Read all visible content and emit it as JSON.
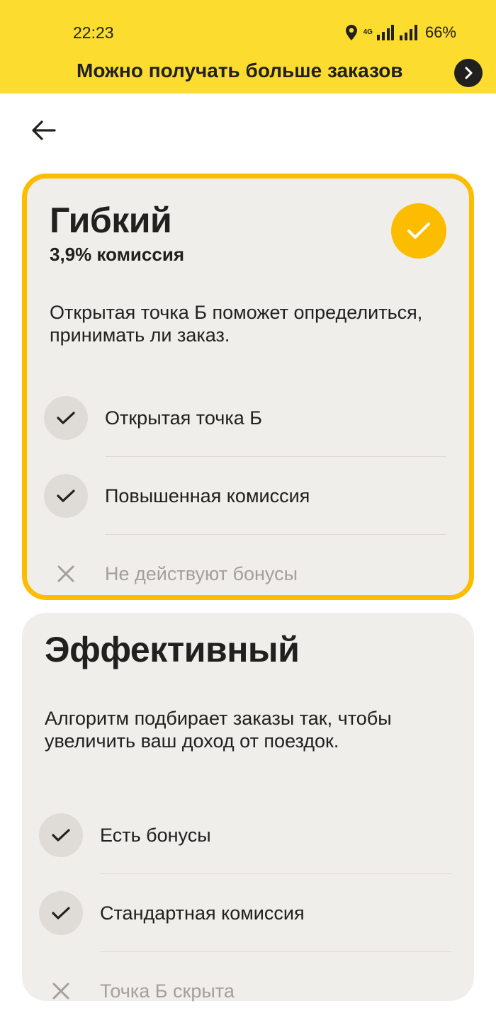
{
  "status_bar": {
    "time": "22:23",
    "network": "4G",
    "battery": "66%",
    "icons": [
      "location-icon",
      "mobile-data-icon",
      "signal-icon"
    ]
  },
  "banner": {
    "text": "Можно получать больше заказов",
    "icon": "chevron-right-icon"
  },
  "nav": {
    "back_icon": "arrow-left-icon"
  },
  "colors": {
    "header_bg": "#fcdc2e",
    "accent": "#fcbc00",
    "card_bg": "#f0eeeb",
    "text": "#21201f",
    "muted": "#a3a09c"
  },
  "modes": [
    {
      "title": "Гибкий",
      "commission": "3,9% комиссия",
      "selected": true,
      "description": "Открытая точка Б поможет определиться, принимать ли заказ.",
      "features": [
        {
          "label": "Открытая точка Б",
          "included": true
        },
        {
          "label": "Повышенная комиссия",
          "included": true
        },
        {
          "label": "Не действуют бонусы",
          "included": false
        }
      ]
    },
    {
      "title": "Эффективный",
      "selected": false,
      "description": "Алгоритм подбирает заказы так, чтобы увеличить ваш доход от поездок.",
      "features": [
        {
          "label": "Есть бонусы",
          "included": true
        },
        {
          "label": "Стандартная комиссия",
          "included": true
        },
        {
          "label": "Точка Б скрыта",
          "included": false
        }
      ]
    }
  ]
}
